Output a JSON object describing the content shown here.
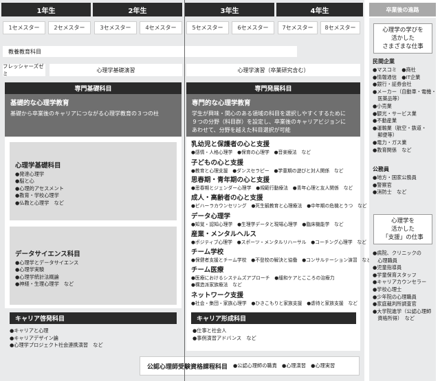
{
  "years": [
    "1年生",
    "2年生",
    "3年生",
    "4年生"
  ],
  "semesters": [
    "1セメスター",
    "2セメスター",
    "3セメスター",
    "4セメスター",
    "5セメスター",
    "6セメスター",
    "7セメスター",
    "8セメスター"
  ],
  "after_grad_title": "卒業後の進路",
  "rows": {
    "liberal_arts": "教養教育科目",
    "freshers_seminar": "フレッシャーズゼミ",
    "basic_seminar": "心理学基礎演習",
    "advanced_seminar": "心理学演習（卒業研究含む）"
  },
  "left": {
    "head": "専門基礎科目",
    "box_title": "基礎的な心理学教育",
    "box_desc": "基礎から卒業後のキャリアにつながる心理学教育の３つの柱",
    "groups": [
      {
        "title": "心理学基礎科目",
        "items": [
          "●発達心理学",
          "●脳と心",
          "●心理的アセスメント",
          "●教育・学校心理学",
          "●仏教と心理学　など"
        ]
      },
      {
        "title": "データサイエンス科目",
        "items": [
          "●心理学とデータサイエンス",
          "●心理学実験",
          "●心理学統計法概論",
          "●神経・生理心理学　など"
        ]
      }
    ],
    "career_head": "キャリア啓発科目",
    "career_items": [
      "●キャリアと心理",
      "●キャリアデザイン論",
      "●心理学プロジェクト社会連携演習　など"
    ]
  },
  "right_main": {
    "head": "専門発展科目",
    "box_title": "専門的な心理学教育",
    "box_desc": [
      "学生が興味・関心のある領域の科目を選択しやすくするために",
      "９つの分野（科目群）を設定し、卒業後のキャリアビジョンに",
      "あわせて、分野を越えた科目選択が可能"
    ],
    "fields": [
      {
        "title": "乳幼児と保護者の心と支援",
        "items": "●感情・人格心理学　●保育の心理学　●音楽療法　など"
      },
      {
        "title": "子どもの心と支援",
        "items": "●教育と心理支援　●ダンスセラピー　●学童期の遊びと対人関係　など"
      },
      {
        "title": "思春期・青年期の心と支援",
        "items": "●思春期とジェンダー心理学　●規範行動療法　●青年心理と友人関係　など"
      },
      {
        "title": "成人・高齢者の心と支援",
        "items": "●ピハーラカウンセリング　●死生観教育と心理療法　●中年期の危機とうつ　など"
      },
      {
        "title": "データ心理学",
        "items": "●知覚・認知心理学　●生理学データと現場心理学　●臨床機能学　など"
      },
      {
        "title": "産業・メンタルヘルス",
        "items": "●ポジティブ心理学　●スポーツ・メンタルリハーサル　●コーチング心理学　など"
      },
      {
        "title": "チーム学校",
        "items": "●保健者支援とチーム学校　●不登校の解決と協働　●コンサルテーション演習　など"
      },
      {
        "title": "チーム医療",
        "items": "●医療におけるシステムズアプローチ　●緩和ケアとこころの治療力",
        "items2": "●構造派家族療法　など"
      },
      {
        "title": "ネットワーク支援",
        "items": "●社会・集団・家族心理学　●ひきこもりと家族支援　●虐待と家族支援　など"
      }
    ],
    "career_head": "キャリア形成科目",
    "career_items": [
      "●仕事と社会人",
      "●事例演習アドバンス　など"
    ]
  },
  "bottom": {
    "label": "公認心理師受験資格課程科目",
    "items": "●公認心理師の職責　●心理演習　●心理実習"
  },
  "after": {
    "box1": [
      "心理学の学びを",
      "活かした",
      "さまざまな仕事"
    ],
    "private_title": "民間企業",
    "private_items": [
      "●マスコミ　●商社",
      "●情報通信　●IT企業",
      "●銀行・証券会社",
      "●メーカー（自動車・電機・",
      "　医薬品等）",
      "●小売業",
      "●観光・サービス業",
      "●不動産業",
      "●運輸業（航空・鉄道・",
      "　郵便等）",
      "●電力・ガス業",
      "●教育関係　など"
    ],
    "public_title": "公務員",
    "public_items": [
      "●地方・国家公務員",
      "●警察官",
      "●消防士　など"
    ],
    "box2": [
      "心理学を",
      "活かした",
      "「支援」の仕事"
    ],
    "support_items": [
      "●病院、クリニックの",
      "　心理職員",
      "●児童指導員",
      "●学童保育スタッフ",
      "●キャリアカウンセラー",
      "●学校心理士",
      "●少年院の心理職員",
      "●家庭裁判所調査官",
      "●大学院進学（公認心理師",
      "　資格所得）　など"
    ]
  }
}
